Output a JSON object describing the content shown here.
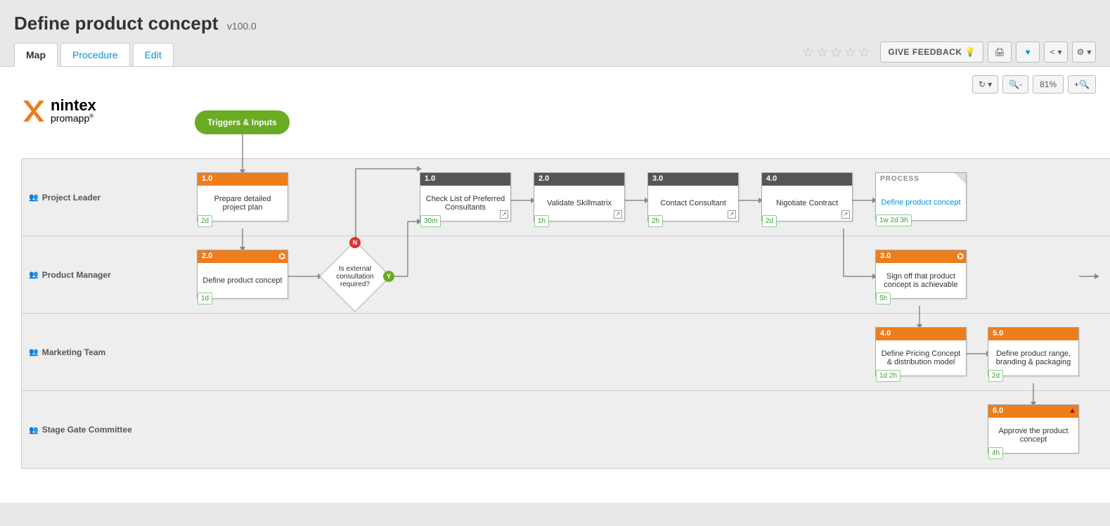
{
  "header": {
    "title": "Define product concept",
    "version": "v100.0"
  },
  "tabs": {
    "map": "Map",
    "procedure": "Procedure",
    "edit": "Edit"
  },
  "toolbar": {
    "feedback": "GIVE FEEDBACK",
    "zoom": "81%"
  },
  "trigger": "Triggers & Inputs",
  "lanes": [
    "Project Leader",
    "Product Manager",
    "Marketing Team",
    "Stage Gate Committee"
  ],
  "decision": {
    "text": "Is external consultation required?",
    "no": "N",
    "yes": "Y"
  },
  "process": {
    "label": "PROCESS",
    "title": "Define product concept",
    "time": "1w 2d 3h"
  },
  "nodes": {
    "n1": {
      "num": "1.0",
      "title": "Prepare detailed project plan",
      "time": "2d"
    },
    "n2": {
      "num": "2.0",
      "title": "Define product concept",
      "time": "1d"
    },
    "s1": {
      "num": "1.0",
      "title": "Check List of Preferred Consultants",
      "time": "30m"
    },
    "s2": {
      "num": "2.0",
      "title": "Validate Skillmatrix",
      "time": "1h"
    },
    "s3": {
      "num": "3.0",
      "title": "Contact Consultant",
      "time": "2h"
    },
    "s4": {
      "num": "4.0",
      "title": "Nigotiate Contract",
      "time": "2d"
    },
    "n3": {
      "num": "3.0",
      "title": "Sign off that product concept is achievable",
      "time": "5h"
    },
    "n4": {
      "num": "4.0",
      "title": "Define Pricing Concept & distribution model",
      "time": "1d 2h"
    },
    "n5": {
      "num": "5.0",
      "title": "Define product range, branding & packaging",
      "time": "2d"
    },
    "n6": {
      "num": "6.0",
      "title": "Approve the product concept",
      "time": "4h"
    }
  }
}
